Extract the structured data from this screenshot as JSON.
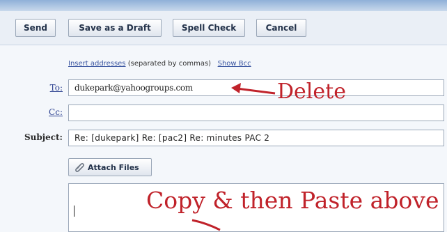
{
  "toolbar": {
    "send_label": "Send",
    "draft_label": "Save as a Draft",
    "spell_label": "Spell Check",
    "cancel_label": "Cancel"
  },
  "compose": {
    "instructions_link": "Insert addresses",
    "instructions_text": "(separated by commas)",
    "show_bcc": "Show Bcc",
    "to_label": "To:",
    "to_value": "dukepark@yahoogroups.com",
    "cc_label": "Cc:",
    "cc_value": "",
    "subject_label": "Subject:",
    "subject_value": "Re: [dukepark] Re: [pac2] Re: minutes PAC 2",
    "attach_label": "Attach Files"
  },
  "annotations": {
    "delete_text": "Delete",
    "copy_text": "Copy & then Paste above",
    "color": "#c0222a"
  },
  "icons": [
    "paperclip-icon",
    "arrow-left-icon",
    "arrow-down-icon"
  ]
}
